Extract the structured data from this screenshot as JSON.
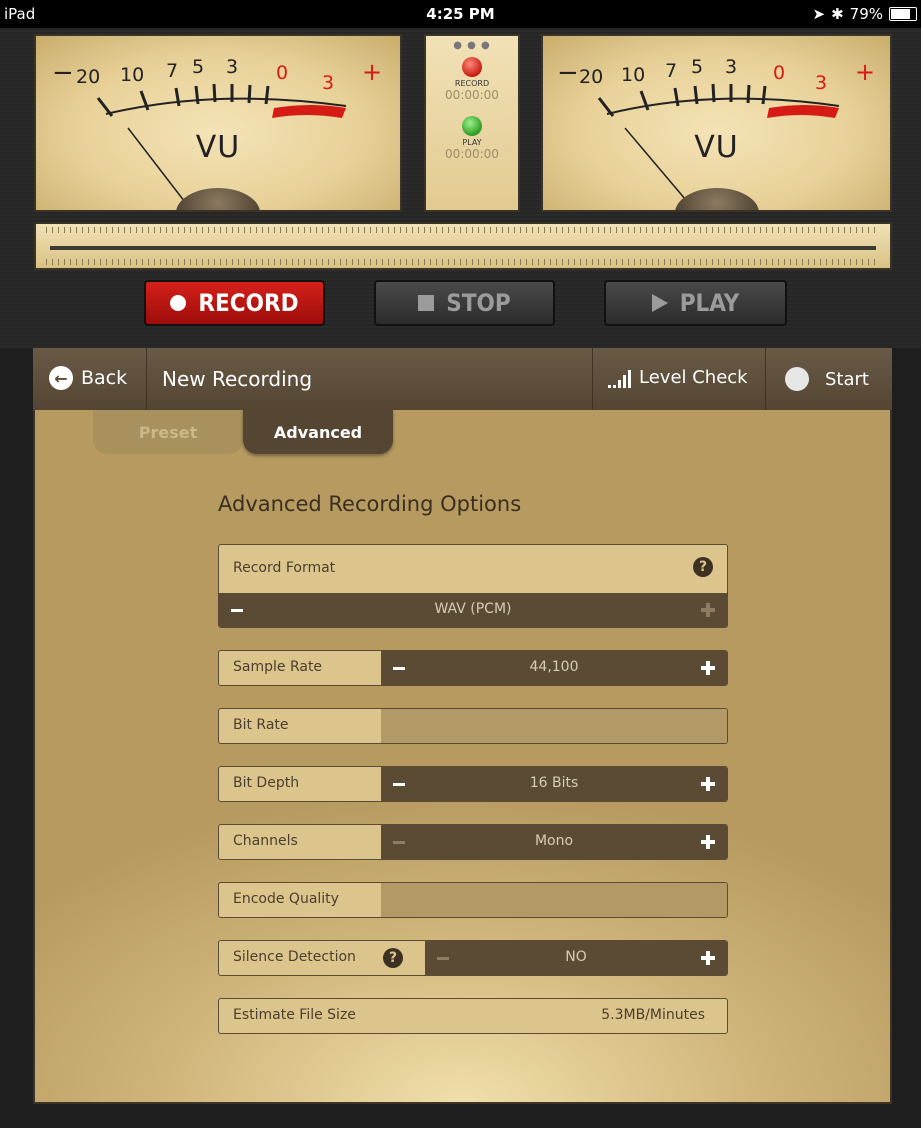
{
  "status_bar": {
    "device": "iPad",
    "time": "4:25 PM",
    "battery": "79%"
  },
  "meters": {
    "scale_left": {
      "minus": "−",
      "s20": "20",
      "s10": "10",
      "s7": "7",
      "s5": "5",
      "s3": "3",
      "s0": "0",
      "r3": "3",
      "plus": "+"
    },
    "vu_label": "VU"
  },
  "recorder_status": {
    "record_label": "RECORD",
    "record_time": "00:00:00",
    "play_label": "PLAY",
    "play_time": "00:00:00"
  },
  "transport": {
    "record": "RECORD",
    "stop": "STOP",
    "play": "PLAY"
  },
  "nav": {
    "back": "Back",
    "title": "New Recording",
    "level_check": "Level Check",
    "start": "Start"
  },
  "tabs": {
    "preset": "Preset",
    "advanced": "Advanced"
  },
  "advanced": {
    "title": "Advanced Recording Options",
    "record_format": {
      "label": "Record Format",
      "value": "WAV (PCM)"
    },
    "sample_rate": {
      "label": "Sample Rate",
      "value": "44,100"
    },
    "bit_rate": {
      "label": "Bit Rate"
    },
    "bit_depth": {
      "label": "Bit Depth",
      "value": "16 Bits"
    },
    "channels": {
      "label": "Channels",
      "value": "Mono"
    },
    "encode_quality": {
      "label": "Encode Quality"
    },
    "silence_detection": {
      "label": "Silence Detection",
      "value": "NO"
    },
    "estimate_file_size": {
      "label": "Estimate File Size",
      "value": "5.3MB/Minutes"
    }
  },
  "icons": {
    "help": "question-mark-icon",
    "back": "back-arrow-icon",
    "level": "signal-bars-icon"
  },
  "colors": {
    "record_red": "#c71b10",
    "panel_brown": "#544633",
    "parchment": "#dcc58d"
  }
}
